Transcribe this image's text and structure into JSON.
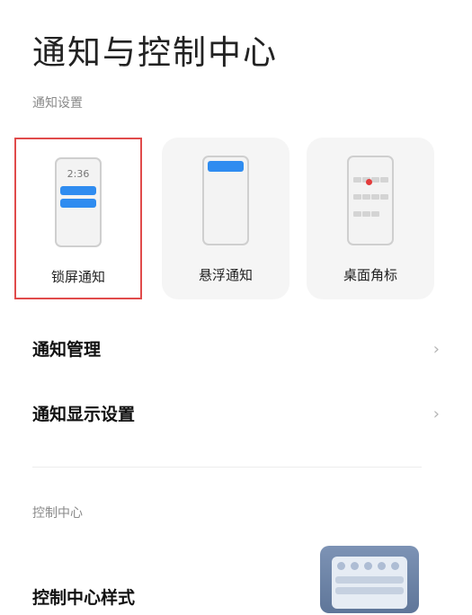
{
  "page": {
    "title": "通知与控制中心"
  },
  "notification_settings": {
    "section_label": "通知设置",
    "cards": [
      {
        "label": "锁屏通知",
        "preview_time": "2:36",
        "selected": true
      },
      {
        "label": "悬浮通知",
        "selected": false
      },
      {
        "label": "桌面角标",
        "selected": false
      }
    ],
    "accent_color": "#2f8cf0",
    "selection_border_color": "#e04b4b",
    "badge_color": "#e33b3b"
  },
  "rows": [
    {
      "label": "通知管理",
      "icon": "chevron-right-icon"
    },
    {
      "label": "通知显示设置",
      "icon": "chevron-right-icon"
    }
  ],
  "control_center": {
    "section_label": "控制中心",
    "style_row": {
      "label": "控制中心样式"
    }
  }
}
